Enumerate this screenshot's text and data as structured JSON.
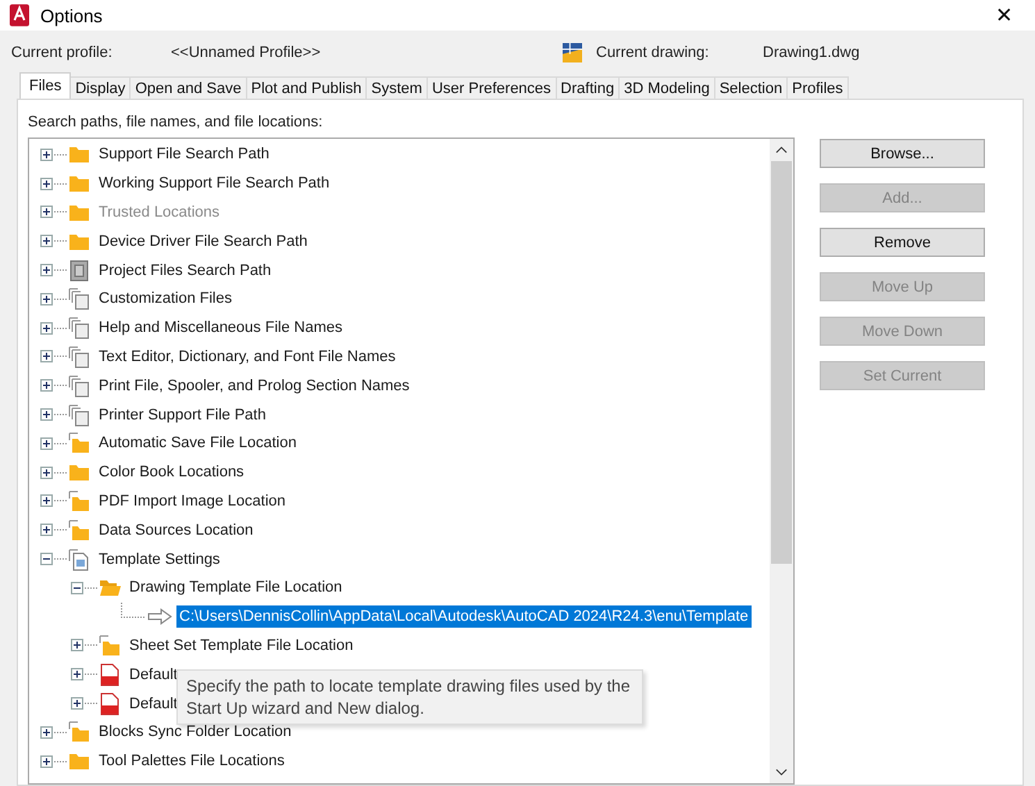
{
  "window": {
    "title": "Options",
    "close": "✕"
  },
  "profile": {
    "label": "Current profile:",
    "value": "<<Unnamed Profile>>",
    "drawing_label": "Current drawing:",
    "drawing_value": "Drawing1.dwg"
  },
  "tabs": [
    {
      "label": "Files",
      "selected": true
    },
    {
      "label": "Display",
      "selected": false
    },
    {
      "label": "Open and Save",
      "selected": false
    },
    {
      "label": "Plot and Publish",
      "selected": false
    },
    {
      "label": "System",
      "selected": false
    },
    {
      "label": "User Preferences",
      "selected": false
    },
    {
      "label": "Drafting",
      "selected": false
    },
    {
      "label": "3D Modeling",
      "selected": false
    },
    {
      "label": "Selection",
      "selected": false
    },
    {
      "label": "Profiles",
      "selected": false
    }
  ],
  "tree_label": "Search paths, file names, and file locations:",
  "tree": [
    {
      "label": "Support File Search Path",
      "kind": "folder",
      "expanded": false,
      "disabled": false
    },
    {
      "label": "Working Support File Search Path",
      "kind": "folder",
      "expanded": false,
      "disabled": false
    },
    {
      "label": "Trusted Locations",
      "kind": "folder",
      "expanded": false,
      "disabled": true
    },
    {
      "label": "Device Driver File Search Path",
      "kind": "folder",
      "expanded": false,
      "disabled": false
    },
    {
      "label": "Project Files Search Path",
      "kind": "project",
      "expanded": false,
      "disabled": false
    },
    {
      "label": "Customization Files",
      "kind": "files",
      "expanded": false,
      "disabled": false
    },
    {
      "label": "Help and Miscellaneous File Names",
      "kind": "files",
      "expanded": false,
      "disabled": false
    },
    {
      "label": "Text Editor, Dictionary, and Font File Names",
      "kind": "files",
      "expanded": false,
      "disabled": false
    },
    {
      "label": "Print File, Spooler, and Prolog Section Names",
      "kind": "files",
      "expanded": false,
      "disabled": false
    },
    {
      "label": "Printer Support File Path",
      "kind": "files",
      "expanded": false,
      "disabled": false
    },
    {
      "label": "Automatic Save File Location",
      "kind": "folder-files",
      "expanded": false,
      "disabled": false
    },
    {
      "label": "Color Book Locations",
      "kind": "folder",
      "expanded": false,
      "disabled": false
    },
    {
      "label": "PDF Import Image Location",
      "kind": "folder-files",
      "expanded": false,
      "disabled": false
    },
    {
      "label": "Data Sources Location",
      "kind": "folder-files",
      "expanded": false,
      "disabled": false
    },
    {
      "label": "Template Settings",
      "kind": "document",
      "expanded": true,
      "disabled": false,
      "children": [
        {
          "label": "Drawing Template File Location",
          "kind": "folder-open",
          "expanded": true,
          "disabled": false,
          "children": [
            {
              "label": "C:\\Users\\DennisCollin\\AppData\\Local\\Autodesk\\AutoCAD 2024\\R24.3\\enu\\Template",
              "kind": "path",
              "selected": true
            }
          ]
        },
        {
          "label": "Sheet Set Template File Location",
          "kind": "folder-files",
          "expanded": false,
          "disabled": false
        },
        {
          "label": "Default",
          "kind": "template-file",
          "expanded": false,
          "disabled": false
        },
        {
          "label": "Default",
          "kind": "template-file",
          "expanded": false,
          "disabled": false
        }
      ]
    },
    {
      "label": "Blocks Sync Folder Location",
      "kind": "folder-files",
      "expanded": false,
      "disabled": false
    },
    {
      "label": "Tool Palettes File Locations",
      "kind": "folder",
      "expanded": false,
      "disabled": false
    }
  ],
  "tooltip": "Specify the path to locate template drawing files used by the Start Up wizard and New dialog.",
  "buttons": [
    {
      "label": "Browse...",
      "disabled": false
    },
    {
      "label": "Add...",
      "disabled": true
    },
    {
      "label": "Remove",
      "disabled": false
    },
    {
      "label": "Move Up",
      "disabled": true
    },
    {
      "label": "Move Down",
      "disabled": true
    },
    {
      "label": "Set Current",
      "disabled": true
    }
  ]
}
